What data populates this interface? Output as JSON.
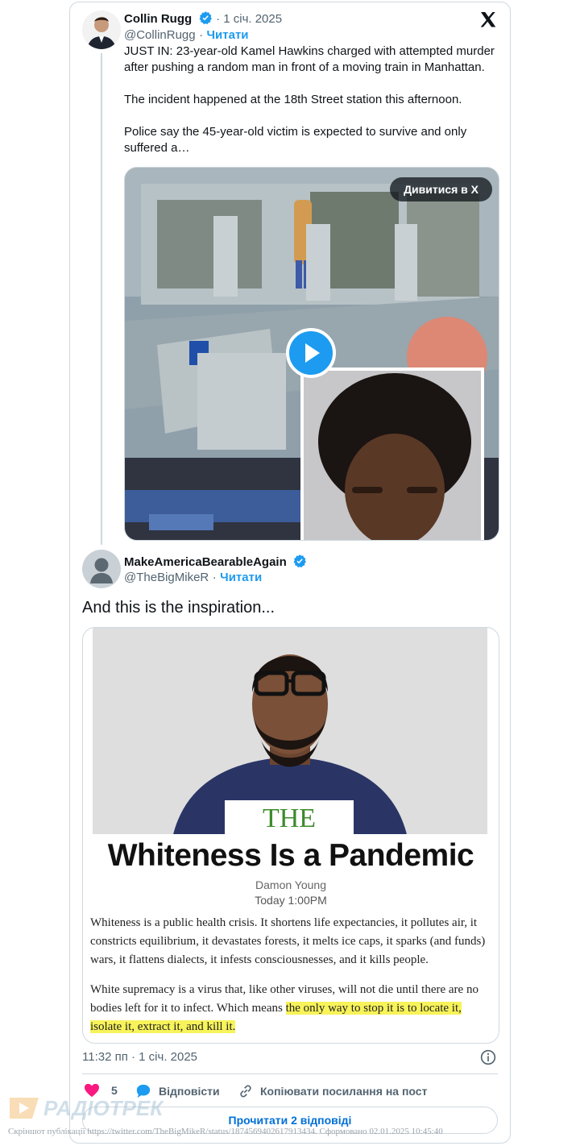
{
  "quoted_post": {
    "author_name": "Collin Rugg",
    "date": "· 1 січ. 2025",
    "handle": "@CollinRugg",
    "separator": "·",
    "follow_label": "Читати",
    "text": "JUST IN: 23-year-old Kamel Hawkins charged with attempted murder after pushing a random man in front of a moving train in Manhattan.\n\nThe incident happened at the 18th Street station this afternoon.\n\nPolice say the 45-year-old victim is expected to survive and only suffered a…",
    "watch_label": "Дивитися в X"
  },
  "main_post": {
    "author_name": "MakeAmericaBearableAgain",
    "handle": "@TheBigMikeR",
    "separator": "·",
    "follow_label": "Читати",
    "text": "And this is the inspiration...",
    "image": {
      "publication": "THE ROOT",
      "headline": "Whiteness Is a Pandemic",
      "byline": "Damon Young",
      "time": "Today 1:00PM",
      "paragraph_1": "Whiteness is a public health crisis. It shortens life expectancies, it pollutes air, it constricts equilibrium, it devastates forests, it melts ice caps, it sparks (and funds) wars, it flattens dialects, it infests consciousnesses, and it kills people.",
      "paragraph_2_plain": "White supremacy is a virus that, like other viruses, will not die until there are no bodies left for it to infect. Which means ",
      "paragraph_2_highlight": "the only way to stop it is to locate it, isolate it, extract it, and kill it."
    },
    "timestamp": "11:32 пп · 1 січ. 2025",
    "likes_count": "5",
    "reply_label": "Відповісти",
    "copy_link_label": "Копіювати посилання на пост",
    "read_replies_label": "Прочитати 2 відповіді"
  },
  "footer": {
    "watermark": "РАДІОТРЕК",
    "caption": "Скріншот публікації https://twitter.com/TheBigMikeR/status/1874569402617913434. Сформовано 02.01.2025 10:45:40"
  },
  "colors": {
    "accent": "#1d9bf0",
    "like": "#f91880",
    "text": "#0f1419",
    "muted": "#536471",
    "border": "#cfd9de",
    "highlight": "#f7f35a"
  }
}
